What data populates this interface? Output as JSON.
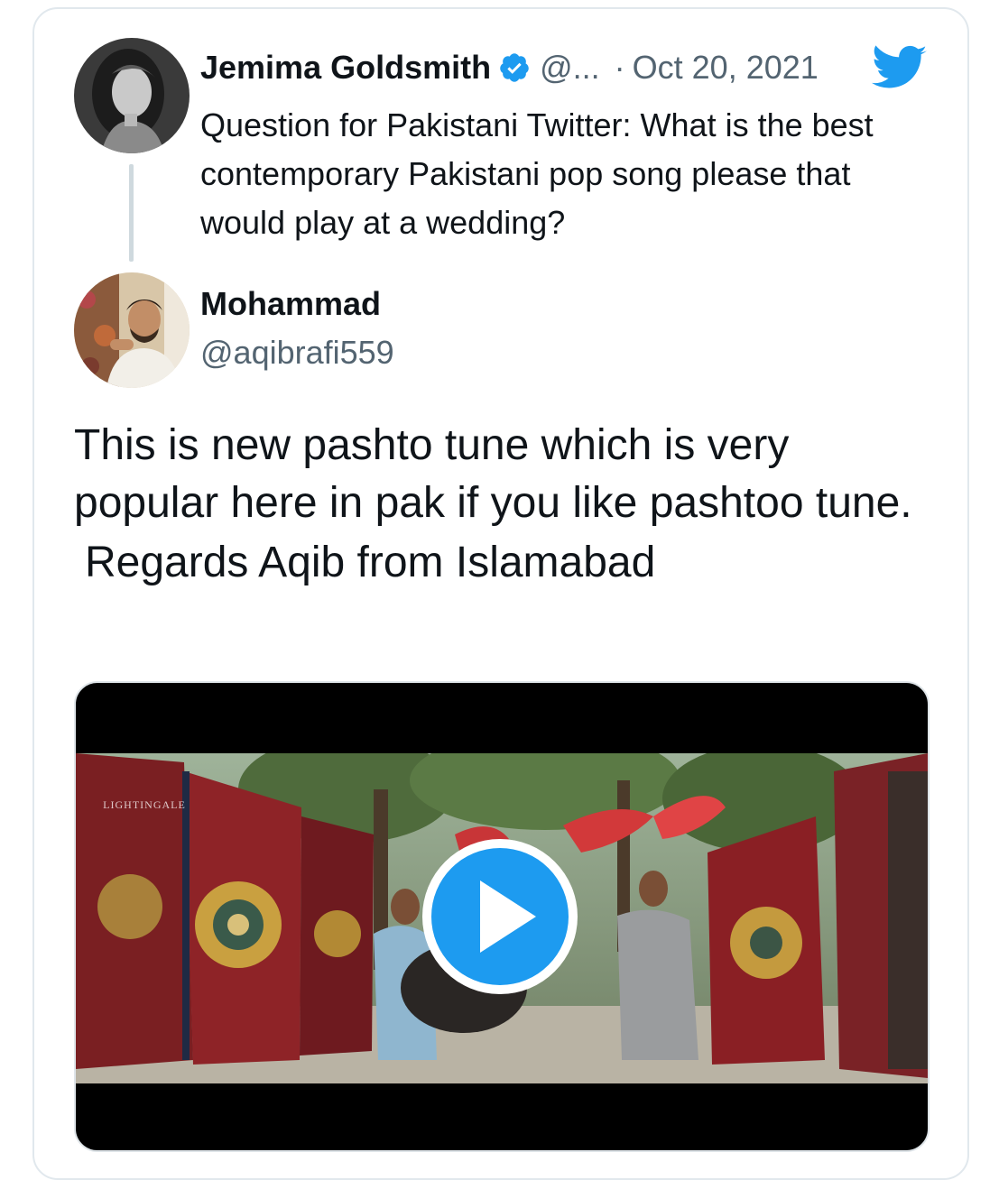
{
  "quoted_tweet": {
    "author_name": "Jemima Goldsmith",
    "handle": "@...",
    "separator": "·",
    "date": "Oct 20, 2021",
    "text": "Question for Pakistani Twitter: What is the best contemporary Pakistani pop song please that would play at a wedding?",
    "verified_icon": "verified-badge-icon",
    "logo_icon": "twitter-bird-icon"
  },
  "reply": {
    "author_name": "Mohammad",
    "handle": "@aqibrafi559",
    "text_line1": "This is new pashto tune which is very popular here in pak if you like pashtoo tune.",
    "text_line2": "Regards Aqib from Islamabad"
  },
  "media": {
    "watermark": "LIGHTINGALE",
    "play_icon": "play-icon"
  },
  "colors": {
    "twitter_blue": "#1d9bf0",
    "text_primary": "#0f1419",
    "text_secondary": "#536471",
    "border": "#e1e8ed"
  }
}
